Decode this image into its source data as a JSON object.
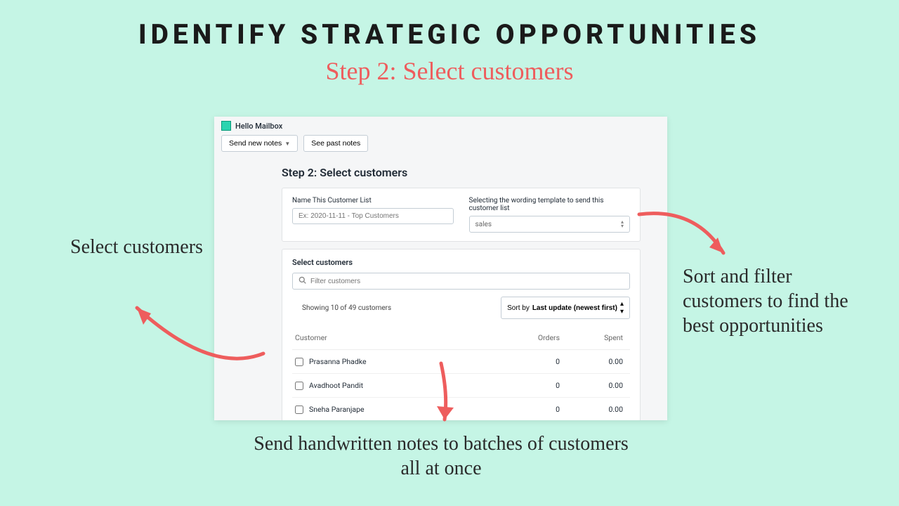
{
  "heading": "IDENTIFY STRATEGIC OPPORTUNITIES",
  "subheading": "Step 2: Select customers",
  "app": {
    "name": "Hello Mailbox",
    "toolbar": {
      "send_new": "Send new notes",
      "see_past": "See past notes"
    },
    "step_title": "Step 2: Select customers",
    "form": {
      "name_label": "Name This Customer List",
      "name_placeholder": "Ex: 2020-11-11 - Top Customers",
      "template_label": "Selecting the wording template to send this customer list",
      "template_value": "sales"
    },
    "list": {
      "title": "Select customers",
      "filter_placeholder": "Filter customers",
      "showing": "Showing 10 of 49 customers",
      "sort_prefix": "Sort by",
      "sort_value": "Last update (newest first)",
      "columns": {
        "customer": "Customer",
        "orders": "Orders",
        "spent": "Spent"
      },
      "rows": [
        {
          "name": "Prasanna Phadke",
          "orders": "0",
          "spent": "0.00"
        },
        {
          "name": "Avadhoot Pandit",
          "orders": "0",
          "spent": "0.00"
        },
        {
          "name": "Sneha Paranjape",
          "orders": "0",
          "spent": "0.00"
        }
      ]
    }
  },
  "annotations": {
    "left": "Select customers",
    "right": "Sort and filter customers to find the best opportunities",
    "bottom": "Send handwritten notes to batches of customers all at once"
  }
}
